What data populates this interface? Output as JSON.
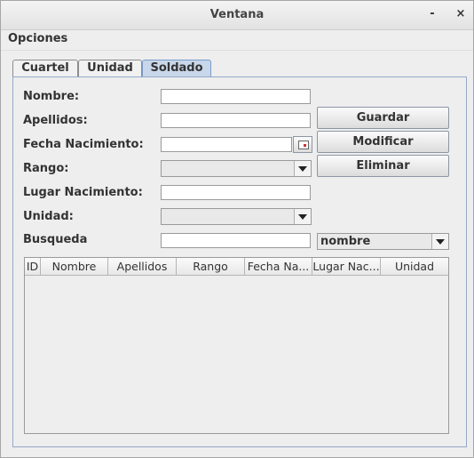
{
  "window": {
    "title": "Ventana",
    "minimize": "-",
    "close": "×"
  },
  "menubar": {
    "options": "Opciones"
  },
  "tabs": [
    {
      "label": "Cuartel",
      "active": false
    },
    {
      "label": "Unidad",
      "active": false
    },
    {
      "label": "Soldado",
      "active": true
    }
  ],
  "form": {
    "nombre_label": "Nombre:",
    "nombre_value": "",
    "apellidos_label": "Apellidos:",
    "apellidos_value": "",
    "fecha_label": "Fecha Nacimiento:",
    "fecha_value": "",
    "rango_label": "Rango:",
    "rango_value": "",
    "lugar_label": "Lugar Nacimiento:",
    "lugar_value": "",
    "unidad_label": "Unidad:",
    "unidad_value": "",
    "busqueda_label": "Busqueda",
    "busqueda_value": "",
    "busqueda_field": "nombre"
  },
  "buttons": {
    "guardar": "Guardar",
    "modificar": "Modificar",
    "eliminar": "Eliminar"
  },
  "table": {
    "columns": [
      "ID",
      "Nombre",
      "Apellidos",
      "Rango",
      "Fecha Na...",
      "Lugar Nac...",
      "Unidad"
    ],
    "rows": []
  },
  "icons": {
    "calendar": "calendar-icon",
    "dropdown": "chevron-down-icon"
  }
}
